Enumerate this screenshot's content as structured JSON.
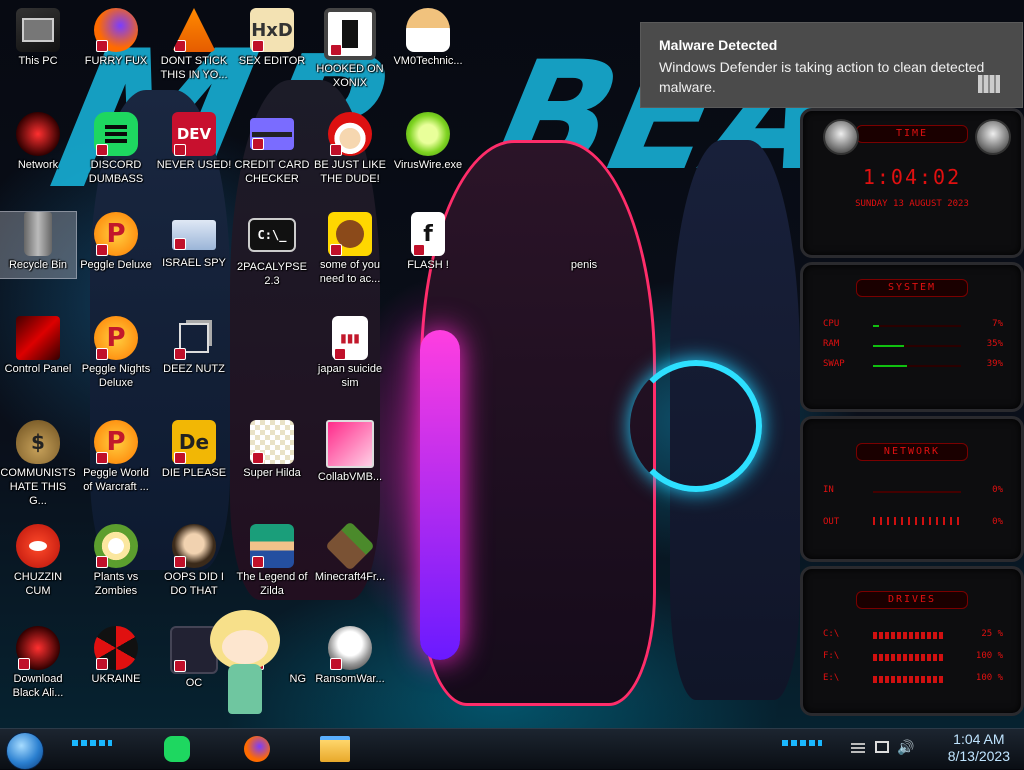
{
  "desktop_icons": [
    {
      "label": "This PC",
      "icon": "computer-icon"
    },
    {
      "label": "FURRY FUX",
      "icon": "firefox-icon"
    },
    {
      "label": "DONT STICK THIS IN YO...",
      "icon": "vlc-cone-icon"
    },
    {
      "label": "SEX EDITOR",
      "icon": "xd-editor-icon"
    },
    {
      "label": "HOOKED ON XONIX",
      "icon": "xonix-game-icon"
    },
    {
      "label": "VM0Technic...",
      "icon": "doctor-icon"
    },
    {
      "label": "Network",
      "icon": "network-alien-icon"
    },
    {
      "label": "DISCORD DUMBASS",
      "icon": "green-chat-icon"
    },
    {
      "label": "NEVER USED!",
      "icon": "dev-cpp-icon"
    },
    {
      "label": "CREDIT CARD CHECKER",
      "icon": "credit-card-icon"
    },
    {
      "label": "BE JUST LIKE THE DUDE!",
      "icon": "santa-icon"
    },
    {
      "label": "VirusWire.exe",
      "icon": "lime-icon"
    },
    {
      "label": "Recycle Bin",
      "icon": "recycle-bin-icon"
    },
    {
      "label": "Peggle Deluxe",
      "icon": "peggle-icon"
    },
    {
      "label": "ISRAEL SPY",
      "icon": "spy-window-icon"
    },
    {
      "label": "2PACALYPSE 2.3",
      "icon": "terminal-icon"
    },
    {
      "label": "some of you need to ac...",
      "icon": "beaver-icon"
    },
    {
      "label": "FLASH !",
      "icon": "flash-icon"
    },
    {
      "label": "penis",
      "icon": "blank-icon"
    },
    {
      "label": "Control Panel",
      "icon": "control-panel-icon"
    },
    {
      "label": "Peggle Nights Deluxe",
      "icon": "peggle-icon"
    },
    {
      "label": "DEEZ NUTZ",
      "icon": "folders-icon"
    },
    {
      "label": "japan suicide sim",
      "icon": "document-icon"
    },
    {
      "label": "COMMUNISTS HATE THIS G...",
      "icon": "money-bag-icon"
    },
    {
      "label": "Peggle World of Warcraft ...",
      "icon": "peggle-icon"
    },
    {
      "label": "DIE PLEASE",
      "icon": "de-icon"
    },
    {
      "label": "Super Hilda",
      "icon": "pixel-cat-icon"
    },
    {
      "label": "CollabVMB...",
      "icon": "collab-vm-icon"
    },
    {
      "label": "CHUZZIN CUM",
      "icon": "chuzzle-icon"
    },
    {
      "label": "Plants vs Zombies",
      "icon": "pvz-flower-icon"
    },
    {
      "label": "OOPS DID I DO THAT",
      "icon": "portrait-icon"
    },
    {
      "label": "The Legend of Zilda",
      "icon": "zelda-sprite-icon"
    },
    {
      "label": "Minecraft4Fr...",
      "icon": "minecraft-block-icon"
    },
    {
      "label": "Download Black Ali...",
      "icon": "black-alien-icon"
    },
    {
      "label": "UKRAINE",
      "icon": "radiation-icon"
    },
    {
      "label": "OC",
      "icon": "partial-icon"
    },
    {
      "label": "NG",
      "icon": "partial-icon"
    },
    {
      "label": "RansomWar...",
      "icon": "skull-icon"
    }
  ],
  "notification": {
    "title": "Malware Detected",
    "body": "Windows Defender is taking action to clean detected malware."
  },
  "gadget": {
    "time_title": "TIME",
    "time": "1:04:02",
    "date": "SUNDAY 13 AUGUST 2023",
    "system_title": "SYSTEM",
    "system": [
      {
        "label": "CPU",
        "value": "7%",
        "level": 0.07
      },
      {
        "label": "RAM",
        "value": "35%",
        "level": 0.35
      },
      {
        "label": "SWAP",
        "value": "39%",
        "level": 0.39
      }
    ],
    "network_title": "NETWORK",
    "network": [
      {
        "label": "IN",
        "value": "0%"
      },
      {
        "label": "OUT",
        "value": "0%"
      }
    ],
    "drives_title": "DRIVES",
    "drives": [
      {
        "label": "C:\\",
        "value": "25 %"
      },
      {
        "label": "F:\\",
        "value": "100 %"
      },
      {
        "label": "E:\\",
        "value": "100 %"
      }
    ]
  },
  "taskbar": {
    "pinned": [
      "green-chat-icon",
      "firefox-icon",
      "file-explorer-icon"
    ],
    "time": "1:04 AM",
    "date": "8/13/2023",
    "tray_icons": [
      "network-tray-icon",
      "volume-icon",
      "action-center-icon"
    ]
  },
  "colors": {
    "accent_red": "#e01010",
    "toast_bg": "#4b4b4b",
    "wallpaper_cyan": "#18b8e0",
    "neon_pink": "#ff2ad0"
  }
}
